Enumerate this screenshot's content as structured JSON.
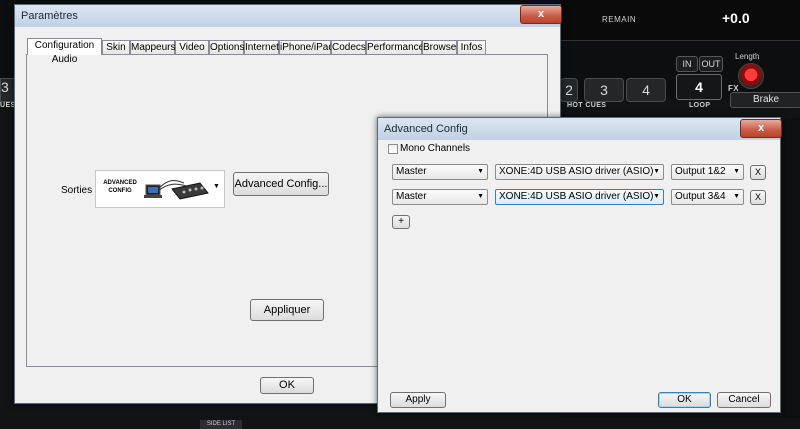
{
  "background_app": {
    "remain_label": "REMAIN",
    "pitch_value": "+0.0",
    "hotcue_labels": [
      "2",
      "3",
      "4"
    ],
    "hotcues_label": "HOT CUES",
    "loop_in": "IN",
    "loop_out": "OUT",
    "loop_value": "4",
    "loop_label": "LOOP",
    "length_label": "Length",
    "fx_label": "FX",
    "brake_label": "Brake",
    "side_list_label": "SIDE LIST",
    "left_fragment": "UES",
    "left_digit": "3"
  },
  "params_window": {
    "title": "Paramètres",
    "close": "x",
    "tabs": [
      "Configuration Audio",
      "Skin",
      "Mappeurs",
      "Video",
      "Options",
      "Internet",
      "iPhone/iPad",
      "Codecs",
      "Performances",
      "Browser",
      "Infos"
    ],
    "sorties_label": "Sorties :",
    "logo_line1": "ADVANCED",
    "logo_line2": "CONFIG",
    "advanced_button": "Advanced Config...",
    "apply_button": "Appliquer",
    "ok_button": "OK"
  },
  "advanced_window": {
    "title": "Advanced Config",
    "close": "x",
    "mono_label": "Mono Channels",
    "rows": [
      {
        "channel": "Master",
        "driver": "XONE:4D USB ASIO driver (ASIO)",
        "output": "Output 1&2",
        "remove": "X"
      },
      {
        "channel": "Master",
        "driver": "XONE:4D USB ASIO driver (ASIO)",
        "output": "Output 3&4",
        "remove": "X"
      }
    ],
    "add_button": "+",
    "apply_button": "Apply",
    "ok_button": "OK",
    "cancel_button": "Cancel"
  },
  "colors": {
    "background": "#121314",
    "titlebar": "#c8d7e8",
    "close_red": "#c85b45",
    "knob_red": "#ff3b3b",
    "focus_blue": "#3c7fb1"
  }
}
